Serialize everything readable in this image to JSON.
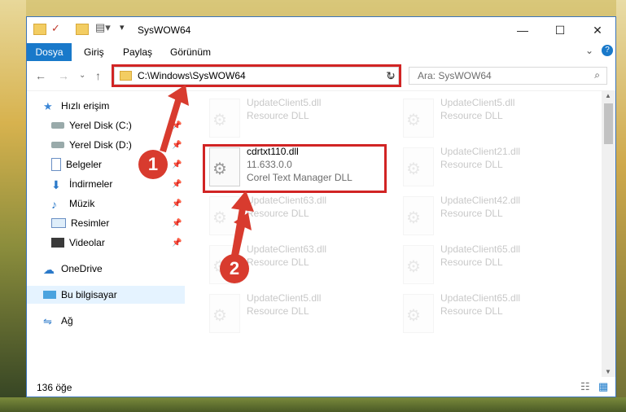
{
  "window": {
    "title": "SysWOW64"
  },
  "ribbon": {
    "tabs": [
      "Dosya",
      "Giriş",
      "Paylaş",
      "Görünüm"
    ]
  },
  "address": {
    "path": "C:\\Windows\\SysWOW64"
  },
  "search": {
    "placeholder": "Ara: SysWOW64"
  },
  "sidebar": {
    "items": [
      {
        "label": "Hızlı erişim",
        "icon": "star-icon"
      },
      {
        "label": "Yerel Disk (C:)",
        "icon": "drive-icon"
      },
      {
        "label": "Yerel Disk (D:)",
        "icon": "drive-icon"
      },
      {
        "label": "Belgeler",
        "icon": "documents-icon"
      },
      {
        "label": "İndirmeler",
        "icon": "download-icon"
      },
      {
        "label": "Müzik",
        "icon": "music-icon"
      },
      {
        "label": "Resimler",
        "icon": "pictures-icon"
      },
      {
        "label": "Videolar",
        "icon": "video-icon"
      },
      {
        "label": "OneDrive",
        "icon": "cloud-icon"
      },
      {
        "label": "Bu bilgisayar",
        "icon": "computer-icon"
      },
      {
        "label": "Ağ",
        "icon": "network-icon"
      }
    ]
  },
  "files": [
    {
      "name": "UpdateClient5.dll",
      "desc": "Resource DLL"
    },
    {
      "name": "UpdateClient5.dll",
      "desc": "Resource DLL"
    },
    {
      "name": "cdrtxt110.dll",
      "version": "11.633.0.0",
      "desc": "Corel Text Manager DLL"
    },
    {
      "name": "UpdateClient21.dll",
      "desc": "Resource DLL"
    },
    {
      "name": "UpdateClient63.dll",
      "desc": "Resource DLL"
    },
    {
      "name": "UpdateClient42.dll",
      "desc": "Resource DLL"
    },
    {
      "name": "UpdateClient63.dll",
      "desc": "Resource DLL"
    },
    {
      "name": "UpdateClient65.dll",
      "desc": "Resource DLL"
    },
    {
      "name": "UpdateClient5.dll",
      "desc": "Resource DLL"
    },
    {
      "name": "UpdateClient65.dll",
      "desc": "Resource DLL"
    }
  ],
  "status": {
    "count": "136 öğe"
  },
  "badges": {
    "one": "1",
    "two": "2"
  },
  "colors": {
    "accent": "#1979ca",
    "highlight": "#d12424"
  }
}
